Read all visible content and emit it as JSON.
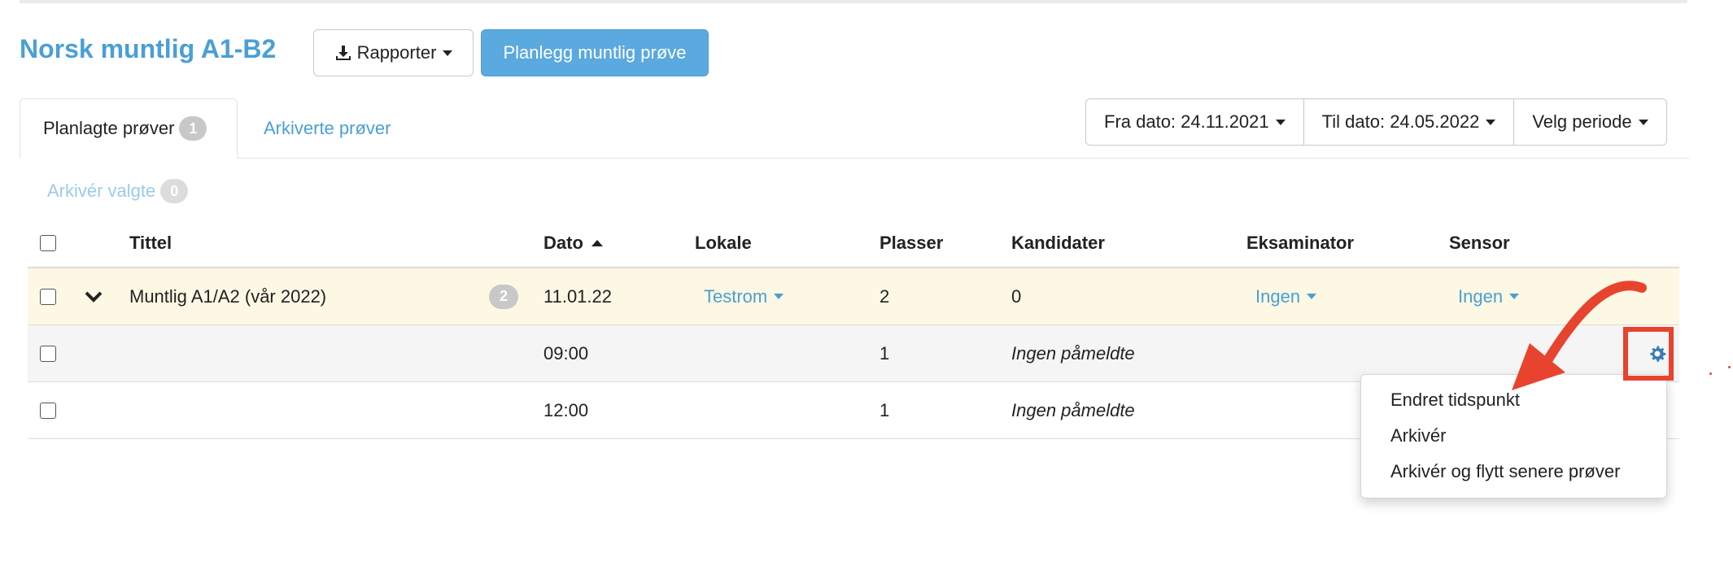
{
  "header": {
    "title": "Norsk muntlig A1-B2",
    "report_button": "Rapporter",
    "plan_button": "Planlegg muntlig prøve"
  },
  "tabs": [
    {
      "label": "Planlagte prøver",
      "count": "1"
    },
    {
      "label": "Arkiverte prøver"
    }
  ],
  "date_filters": {
    "from": "Fra dato: 24.11.2021",
    "to": "Til dato: 24.05.2022",
    "period": "Velg periode"
  },
  "archive_selected": {
    "label": "Arkivér valgte",
    "count": "0"
  },
  "table": {
    "columns": [
      "Tittel",
      "Dato",
      "Lokale",
      "Plasser",
      "Kandidater",
      "Eksaminator",
      "Sensor"
    ],
    "group_row": {
      "title": "Muntlig A1/A2 (vår 2022)",
      "count": "2",
      "date": "11.01.22",
      "location": "Testrom",
      "places": "2",
      "candidates": "0",
      "examiner": "Ingen",
      "sensor": "Ingen"
    },
    "sub_rows": [
      {
        "time": "09:00",
        "places": "1",
        "candidates": "Ingen påmeldte"
      },
      {
        "time": "12:00",
        "places": "1",
        "candidates": "Ingen påmeldte"
      }
    ]
  },
  "dropdown_menu": {
    "items": [
      "Endret tidspunkt",
      "Arkivér",
      "Arkivér og flytt senere prøver"
    ]
  },
  "colors": {
    "accent": "#4a9fd5",
    "primary_button": "#5aa9df",
    "group_row_bg": "#fcf8e3",
    "annotation": "#e8432f"
  }
}
